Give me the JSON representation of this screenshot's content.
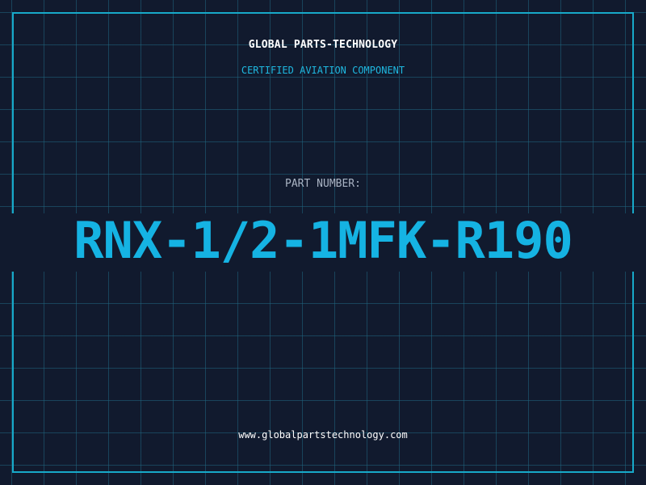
{
  "header": {
    "company_name": "GLOBAL PARTS-TECHNOLOGY",
    "subtitle": "CERTIFIED AVIATION COMPONENT"
  },
  "part": {
    "label": "PART NUMBER:",
    "number": "RNX-1/2-1MFK-R190"
  },
  "footer": {
    "website": "www.globalpartstechnology.com"
  },
  "colors": {
    "background": "#111a2e",
    "grid": "#1f6580",
    "accent": "#15b3e3",
    "frame": "#17a9c9",
    "label": "#aab4c4",
    "text": "#ffffff"
  }
}
